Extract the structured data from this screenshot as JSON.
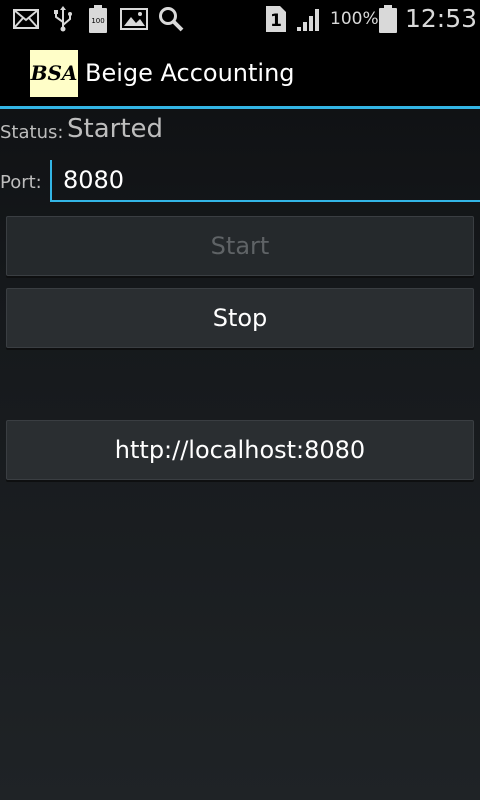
{
  "status_bar": {
    "icons": [
      "mail-icon",
      "usb-icon",
      "battery-full-icon",
      "image-icon",
      "search-icon",
      "sim-1-icon",
      "signal-icon",
      "battery-icon"
    ],
    "battery_small_label": "100",
    "sim_label": "1",
    "battery_percent": "100%",
    "time": "12:53"
  },
  "app_bar": {
    "logo_text": "BSA",
    "title": "Beige Accounting",
    "accent_color": "#33b5e5",
    "logo_bg": "#fffec8"
  },
  "form": {
    "status_label": "Status:",
    "status_value": "Started",
    "port_label": "Port:",
    "port_value": "8080"
  },
  "buttons": {
    "start_label": "Start",
    "start_enabled": false,
    "stop_label": "Stop",
    "url_label": "http://localhost:8080"
  }
}
